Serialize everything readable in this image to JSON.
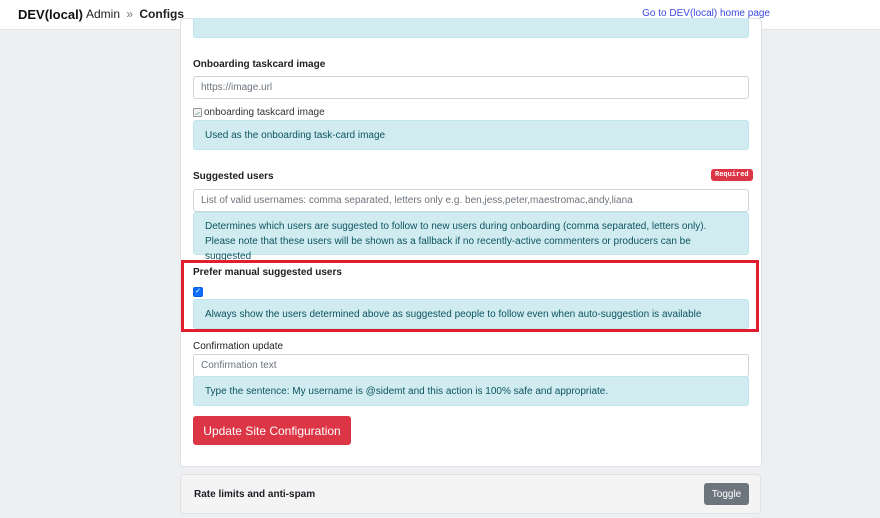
{
  "header": {
    "brand": "DEV(local)",
    "breadcrumb_admin": "Admin",
    "breadcrumb_sep": "»",
    "breadcrumb_current": "Configs",
    "home_link": "Go to DEV(local) home page"
  },
  "onboarding_image": {
    "label": "Onboarding taskcard image",
    "placeholder": "https://image.url",
    "broken_image_alt": "onboarding taskcard image",
    "help": "Used as the onboarding task-card image"
  },
  "suggested_users": {
    "label": "Suggested users",
    "badge": "Required",
    "placeholder": "List of valid usernames: comma separated, letters only e.g. ben,jess,peter,maestromac,andy,liana",
    "help": "Determines which users are suggested to follow to new users during onboarding (comma separated, letters only). Please note that these users will be shown as a fallback if no recently-active commenters or producers can be suggested"
  },
  "prefer_manual": {
    "label": "Prefer manual suggested users",
    "checked": true,
    "help": "Always show the users determined above as suggested people to follow even when auto-suggestion is available"
  },
  "confirmation": {
    "label": "Confirmation update",
    "placeholder": "Confirmation text",
    "help": "Type the sentence: My username is @sidemt and this action is 100% safe and appropriate."
  },
  "submit_label": "Update Site Configuration",
  "next_section": {
    "title": "Rate limits and anti-spam",
    "toggle_label": "Toggle"
  },
  "colors": {
    "accent_red": "#dc3545",
    "info_bg": "#d1ecf1",
    "link_blue": "#3b49df",
    "highlight_red": "#e11d2e"
  }
}
